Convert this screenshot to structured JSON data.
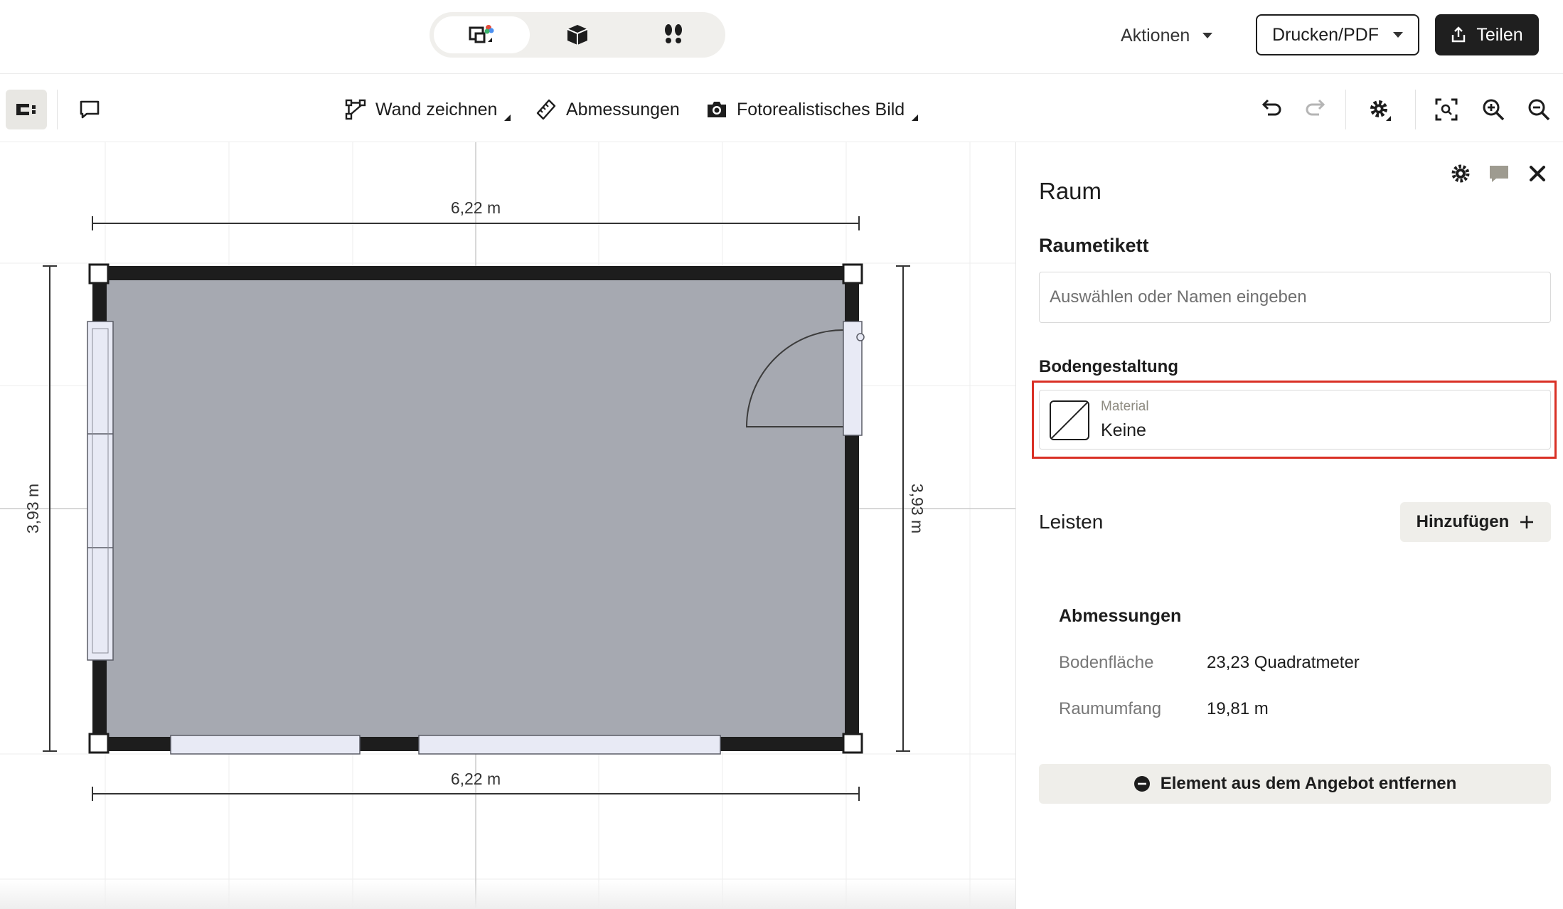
{
  "top_bar": {
    "modes": [
      {
        "name": "2D",
        "icon": "floorplan-2d-icon",
        "active": true
      },
      {
        "name": "3D",
        "icon": "cube-3d-icon",
        "active": false
      },
      {
        "name": "walk",
        "icon": "footsteps-icon",
        "active": false
      }
    ],
    "actions_label": "Aktionen",
    "print_label": "Drucken/PDF",
    "share_label": "Teilen"
  },
  "toolbar": {
    "left_icons": [
      "logo-icon",
      "comment-icon"
    ],
    "tools": [
      {
        "label": "Wand zeichnen",
        "icon": "draw-wall-icon"
      },
      {
        "label": "Abmessungen",
        "icon": "ruler-icon"
      },
      {
        "label": "Fotorealistisches Bild",
        "icon": "camera-icon"
      }
    ],
    "right_icons": [
      "undo-icon",
      "redo-icon",
      "settings-icon",
      "zoom-fit-icon",
      "zoom-in-icon",
      "zoom-out-icon"
    ]
  },
  "canvas": {
    "dim_top": "6,22 m",
    "dim_bottom": "6,22 m",
    "dim_left": "3,93 m",
    "dim_right": "3,93 m",
    "colors": {
      "floor": "#a6a9b1",
      "wall": "#1d1d1d",
      "window": "#e8eaf5"
    }
  },
  "panel": {
    "title": "Raum",
    "room_label_heading": "Raumetikett",
    "room_label_placeholder": "Auswählen oder Namen eingeben",
    "floor_heading": "Bodengestaltung",
    "material_label": "Material",
    "material_value": "Keine",
    "leisten_title": "Leisten",
    "add_label": "Hinzufügen",
    "dimensions_title": "Abmessungen",
    "dimensions": [
      {
        "key": "Bodenfläche",
        "value": "23,23 Quadratmeter"
      },
      {
        "key": "Raumumfang",
        "value": "19,81 m"
      }
    ],
    "remove_label": "Element aus dem Angebot entfernen",
    "highlight_color": "#d93025"
  }
}
